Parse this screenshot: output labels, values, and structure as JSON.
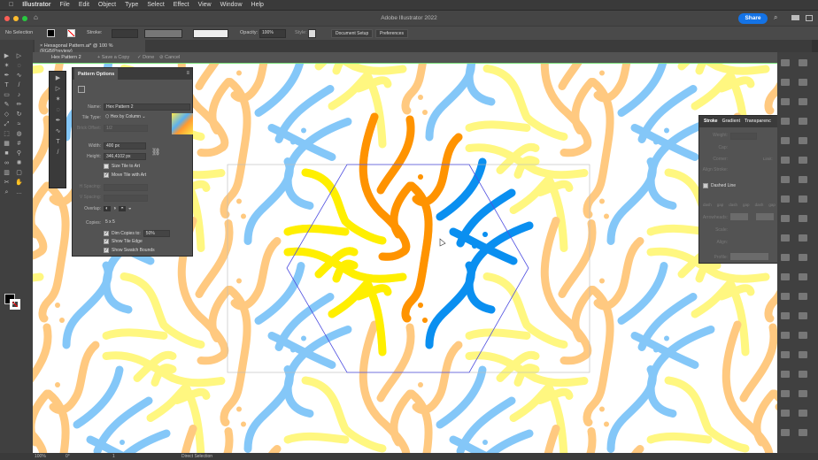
{
  "menu": {
    "apple": "",
    "app": "Illustrator",
    "items": [
      "File",
      "Edit",
      "Object",
      "Type",
      "Select",
      "Effect",
      "View",
      "Window",
      "Help"
    ]
  },
  "window": {
    "title": "Adobe Illustrator 2022",
    "share": "Share"
  },
  "control": {
    "selection": "No Selection",
    "stroke_label": "Stroke:",
    "opacity_label": "Opacity:",
    "opacity": "100%",
    "style_label": "Style:",
    "doc_setup": "Document Setup",
    "preferences": "Preferences"
  },
  "document_tab": {
    "close": "×",
    "title": "Hexagonal Pattern.ai* @ 100 % (RGB/Preview)"
  },
  "isolation": {
    "name": "Hex Pattern 2",
    "save_copy": "+ Save a Copy",
    "done": "✓ Done",
    "cancel": "⊘ Cancel"
  },
  "pattern_options": {
    "title": "Pattern Options",
    "name_label": "Name:",
    "name": "Hex Pattern 2",
    "tile_type_label": "Tile Type:",
    "tile_type": "Hex by Column",
    "brick_offset_label": "Brick Offset:",
    "brick_offset": "1/2",
    "width_label": "Width:",
    "width": "400 px",
    "height_label": "Height:",
    "height": "346,4102 px",
    "size_tile": "Size Tile to Art",
    "size_tile_checked": false,
    "move_tile": "Move Tile with Art",
    "move_tile_checked": true,
    "hspacing_label": "H Spacing:",
    "vspacing_label": "V Spacing:",
    "overlap_label": "Overlap:",
    "copies_label": "Copies:",
    "copies": "5 x 5",
    "dim_copies": "Dim Copies to:",
    "dim_value": "50%",
    "show_tile_edge": "Show Tile Edge",
    "show_swatch_bounds": "Show Swatch Bounds"
  },
  "stroke_panel": {
    "tabs": [
      "Stroke",
      "Gradient",
      "Transparenc"
    ],
    "weight_label": "Weight:",
    "cap_label": "Cap:",
    "corner_label": "Corner:",
    "limit_label": "Limit:",
    "align_label": "Align Stroke:",
    "dashed_line": "Dashed Line",
    "dash_labels": [
      "dash",
      "gap",
      "dash",
      "gap",
      "dash",
      "gap"
    ],
    "arrowheads_label": "Arrowheads:",
    "scale_label": "Scale:",
    "align2_label": "Align:",
    "profile_label": "Profile:"
  },
  "status": {
    "zoom": "100%",
    "rotation": "0°",
    "artboard": "1",
    "tool": "Direct Selection"
  },
  "colors": {
    "orange": "#ff9300",
    "yellow": "#ffef00",
    "blue": "#0a8ff0",
    "pale_orange": "#ffc888",
    "pale_yellow": "#fff38c",
    "pale_blue": "#8ccaf5",
    "tile_edge": "#4f4fe0"
  }
}
